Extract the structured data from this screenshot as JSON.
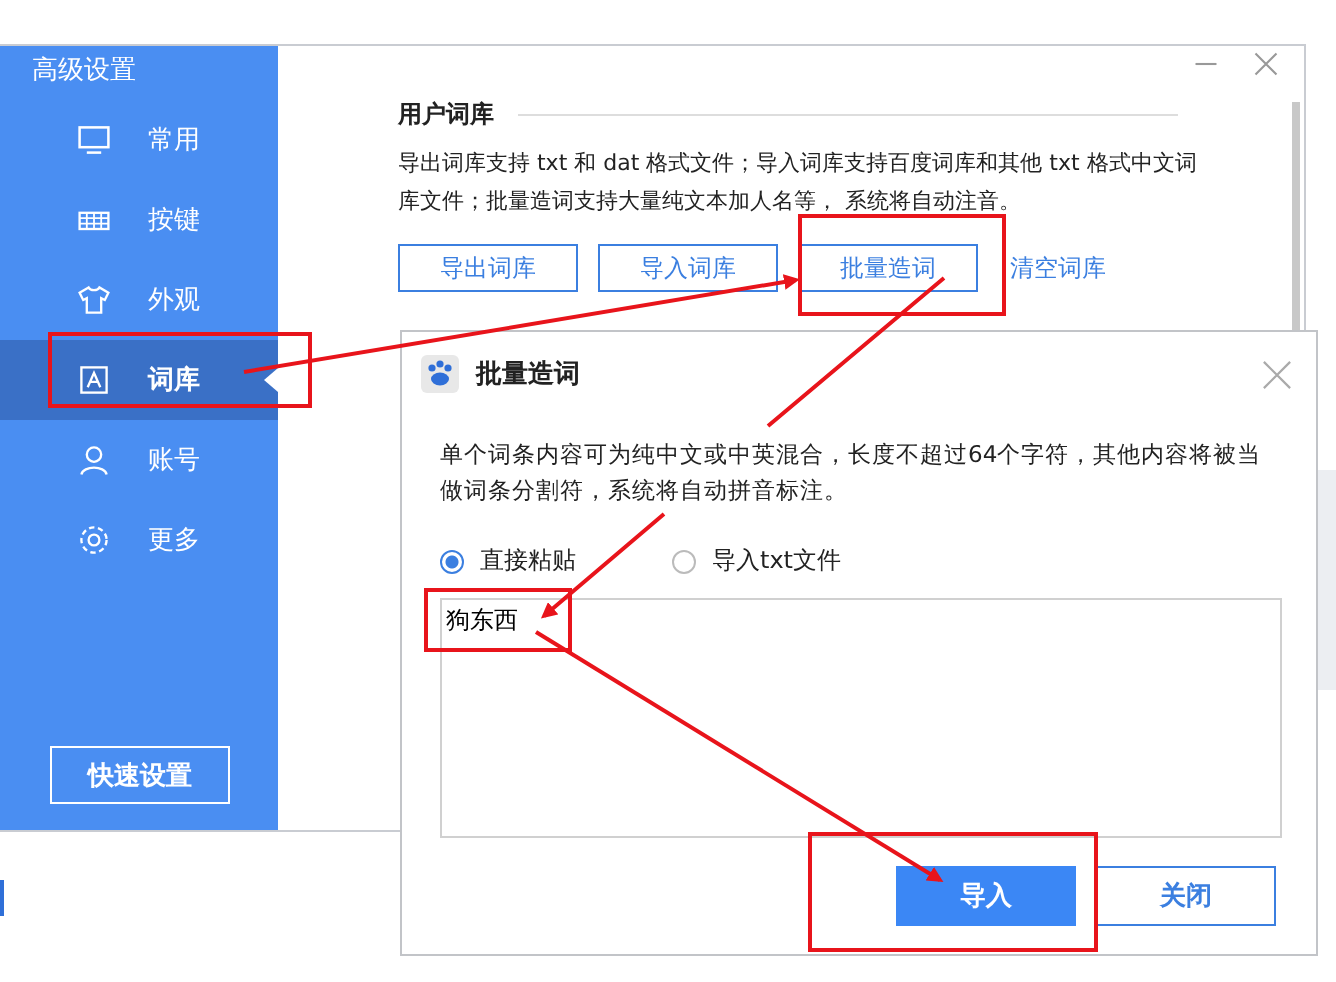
{
  "settings_window": {
    "title": "高级设置",
    "sidebar": {
      "items": [
        {
          "label": "常用",
          "selected": false
        },
        {
          "label": "按键",
          "selected": false
        },
        {
          "label": "外观",
          "selected": false
        },
        {
          "label": "词库",
          "selected": true
        },
        {
          "label": "账号",
          "selected": false
        },
        {
          "label": "更多",
          "selected": false
        }
      ],
      "quick_button": "快速设置"
    },
    "section_title": "用户词库",
    "description": "导出词库支持 txt 和 dat 格式文件；导入词库支持百度词库和其他 txt 格式中文词库文件；批量造词支持大量纯文本加人名等， 系统将自动注音。",
    "buttons": [
      "导出词库",
      "导入词库",
      "批量造词"
    ],
    "link": "清空词库"
  },
  "dialog": {
    "title": "批量造词",
    "description": "单个词条内容可为纯中文或中英混合，长度不超过64个字符，其他内容将被当做词条分割符，系统将自动拼音标注。",
    "options": [
      {
        "label": "直接粘贴",
        "selected": true
      },
      {
        "label": "导入txt文件",
        "selected": false
      }
    ],
    "input_value": "狗东西",
    "buttons": [
      {
        "label": "导入",
        "kind": "primary"
      },
      {
        "label": "关闭",
        "kind": "secondary"
      }
    ]
  }
}
